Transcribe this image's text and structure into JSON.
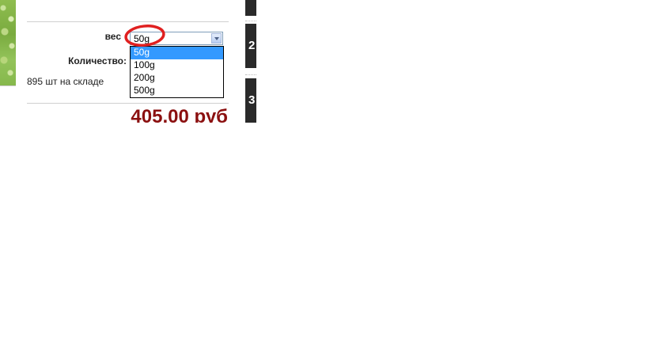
{
  "product": {
    "weight_label": "вес",
    "quantity_label": "Количество:",
    "stock_text": "895 шт на складе",
    "price": "405,00 руб"
  },
  "weight_select": {
    "selected_value": "50g",
    "options": [
      "50g",
      "100g",
      "200g",
      "500g"
    ],
    "highlighted_option": "50g"
  },
  "sidebar": {
    "steps": [
      "",
      "2",
      "3"
    ]
  },
  "colors": {
    "price": "#8b1010",
    "highlight_ring": "#e02020",
    "selected_option_bg": "#3399ff",
    "side_block": "#2a2a2a"
  }
}
